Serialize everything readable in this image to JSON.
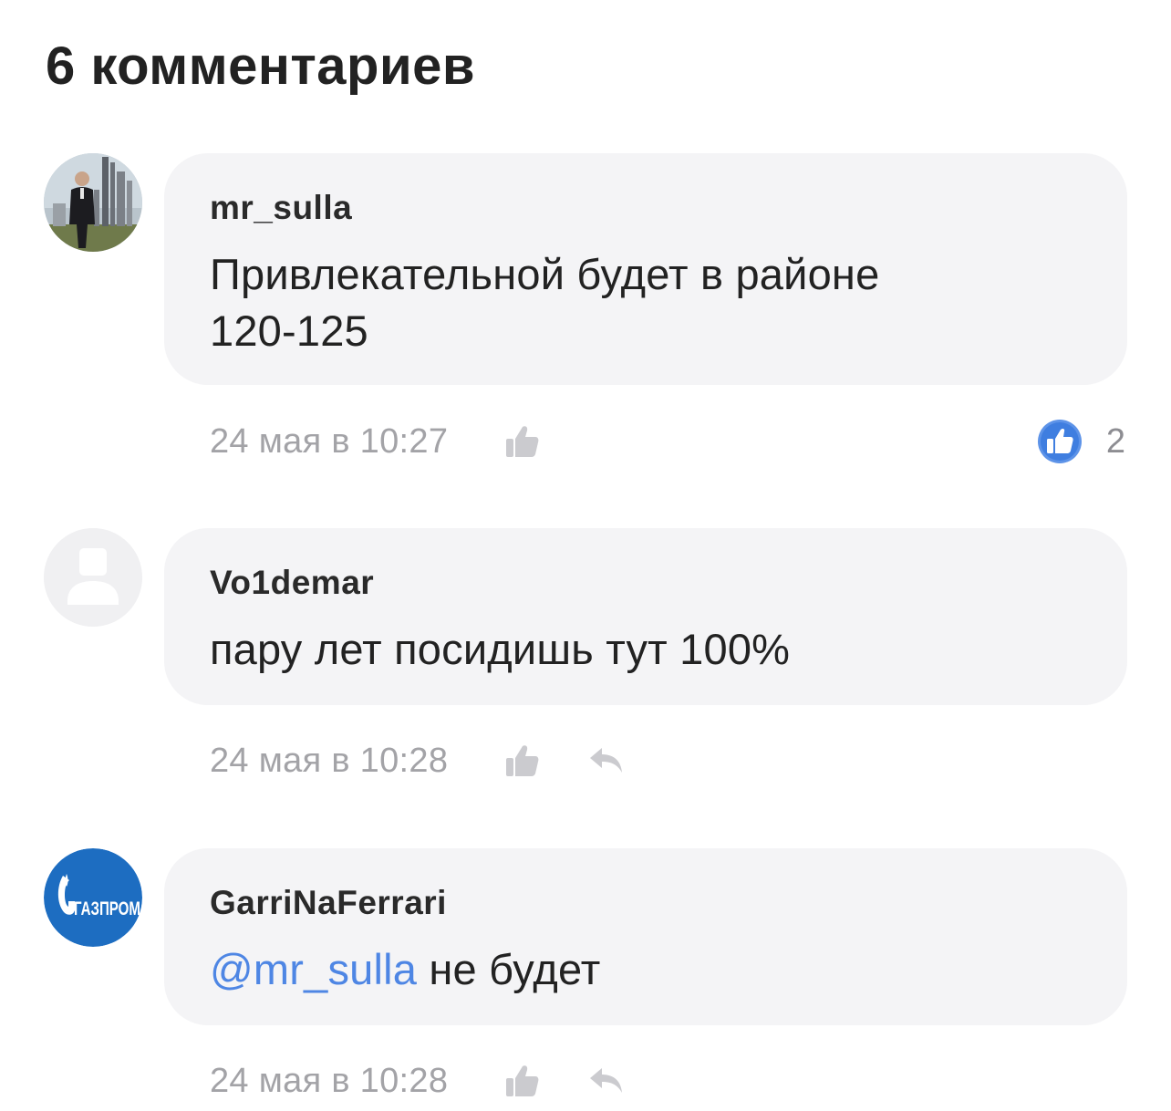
{
  "header": {
    "title": "6 комментариев"
  },
  "comments": [
    {
      "author": "mr_sulla",
      "text": "Привлекательной будет в районе 120-125",
      "text_line1": "Привлекательной будет в районе",
      "text_line2": "120-125",
      "timestamp": "24 мая в 10:27",
      "likes": "2",
      "liked": true,
      "avatar": "photo-avatar-icon"
    },
    {
      "author": "Vo1demar",
      "text": "пару лет посидишь тут 100%",
      "timestamp": "24 мая в 10:28",
      "avatar": "default-user-avatar-icon"
    },
    {
      "author": "GarriNaFerrari",
      "mention": "@mr_sulla",
      "text": " не будет",
      "timestamp": "24 мая в 10:28",
      "avatar": "gazprom-logo-avatar",
      "avatar_logo_text": "ГАЗПРОМ"
    }
  ],
  "colors": {
    "bubble_bg": "#f4f4f6",
    "mention": "#4e86e4",
    "like_active": "#4e86e4",
    "muted_text": "#a3a3a7",
    "icon_gray": "#cbcbcf",
    "gazprom_blue": "#1d6dc1"
  }
}
